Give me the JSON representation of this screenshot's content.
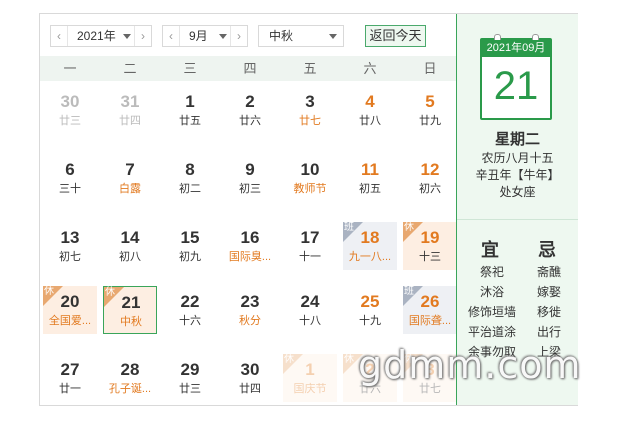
{
  "toolbar": {
    "year": "2021年",
    "month": "9月",
    "holiday": "中秋",
    "today_button": "返回今天",
    "prev": "‹",
    "next": "›"
  },
  "weekdays": [
    "一",
    "二",
    "三",
    "四",
    "五",
    "六",
    "日"
  ],
  "rows": [
    [
      {
        "n": "30",
        "s": "廿三",
        "t": "other"
      },
      {
        "n": "31",
        "s": "廿四",
        "t": "other"
      },
      {
        "n": "1",
        "s": "廿五"
      },
      {
        "n": "2",
        "s": "廿六"
      },
      {
        "n": "3",
        "s": "廿七",
        "hl": true
      },
      {
        "n": "4",
        "s": "廿八",
        "wkd": true
      },
      {
        "n": "5",
        "s": "廿九",
        "wkd": true
      }
    ],
    [
      {
        "n": "6",
        "s": "三十"
      },
      {
        "n": "7",
        "s": "白露",
        "hl": true
      },
      {
        "n": "8",
        "s": "初二"
      },
      {
        "n": "9",
        "s": "初三"
      },
      {
        "n": "10",
        "s": "教师节",
        "hl": true
      },
      {
        "n": "11",
        "s": "初五",
        "wkd": true
      },
      {
        "n": "12",
        "s": "初六",
        "wkd": true
      }
    ],
    [
      {
        "n": "13",
        "s": "初七"
      },
      {
        "n": "14",
        "s": "初八"
      },
      {
        "n": "15",
        "s": "初九"
      },
      {
        "n": "16",
        "s": "国际臭...",
        "hl": true
      },
      {
        "n": "17",
        "s": "十一"
      },
      {
        "n": "18",
        "s": "九一八...",
        "hl": true,
        "wkd": true,
        "tag": "班"
      },
      {
        "n": "19",
        "s": "十三",
        "wkd": true,
        "tag": "休"
      }
    ],
    [
      {
        "n": "20",
        "s": "全国爱...",
        "hl": true,
        "tag": "休"
      },
      {
        "n": "21",
        "s": "中秋",
        "hl": true,
        "tag": "休",
        "today": true
      },
      {
        "n": "22",
        "s": "十六"
      },
      {
        "n": "23",
        "s": "秋分",
        "hl": true
      },
      {
        "n": "24",
        "s": "十八"
      },
      {
        "n": "25",
        "s": "十九",
        "wkd": true
      },
      {
        "n": "26",
        "s": "国际聋...",
        "hl": true,
        "wkd": true,
        "tag": "班"
      }
    ],
    [
      {
        "n": "27",
        "s": "廿一"
      },
      {
        "n": "28",
        "s": "孔子诞...",
        "hl": true
      },
      {
        "n": "29",
        "s": "廿三"
      },
      {
        "n": "30",
        "s": "廿四"
      },
      {
        "n": "1",
        "s": "国庆节",
        "hl": true,
        "tag": "休",
        "faded": true,
        "wkd": true
      },
      {
        "n": "2",
        "s": "廿六",
        "tag": "休",
        "faded": true,
        "wkd": true
      },
      {
        "n": "3",
        "s": "廿七",
        "tag": "休",
        "faded": true,
        "wkd": true
      }
    ]
  ],
  "detail": {
    "header": "2021年09月",
    "day": "21",
    "weekday": "星期二",
    "lunar": "农历八月十五",
    "ganzhi": "辛丑年【牛年】",
    "zodiac": "处女座"
  },
  "yi": {
    "title": "宜",
    "items": [
      "祭祀",
      "沐浴",
      "修饰垣墙",
      "平治道涂",
      "余事勿取"
    ]
  },
  "ji": {
    "title": "忌",
    "items": [
      "斋醮",
      "嫁娶",
      "移徙",
      "出行",
      "上梁"
    ]
  },
  "watermark": "gdmm.com",
  "colors": {
    "accent": "#2a9a4a",
    "holiday": "#e27a20",
    "rest_bg": "#fdeee2",
    "work_bg": "#eef0f4"
  }
}
